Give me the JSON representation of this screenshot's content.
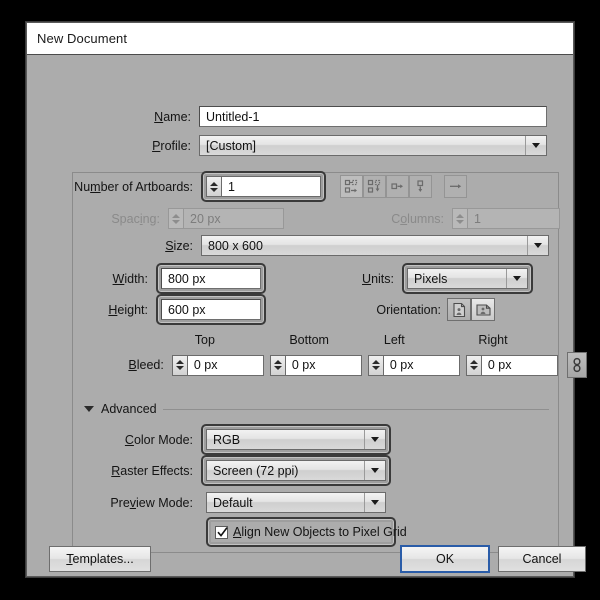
{
  "window": {
    "title": "New Document"
  },
  "fields": {
    "name": {
      "label": "Name:",
      "value": "Untitled-1"
    },
    "profile": {
      "label": "Profile:",
      "value": "[Custom]"
    },
    "artboards": {
      "label": "Number of Artboards:",
      "value": "1"
    },
    "spacing": {
      "label": "Spacing:",
      "value": "20 px",
      "enabled": false
    },
    "columns": {
      "label": "Columns:",
      "value": "1",
      "enabled": false
    },
    "size": {
      "label": "Size:",
      "value": "800 x 600"
    },
    "width": {
      "label": "Width:",
      "value": "800 px"
    },
    "height": {
      "label": "Height:",
      "value": "600 px"
    },
    "units": {
      "label": "Units:",
      "value": "Pixels"
    },
    "orientation": {
      "label": "Orientation:",
      "selected": "portrait"
    },
    "bleed": {
      "label": "Bleed:",
      "headers": [
        "Top",
        "Bottom",
        "Left",
        "Right"
      ],
      "values": [
        "0 px",
        "0 px",
        "0 px",
        "0 px"
      ],
      "link_icon": "chain-link-icon"
    }
  },
  "artboard_layout_buttons": [
    {
      "icon": "grid-by-row-icon",
      "selected": true
    },
    {
      "icon": "grid-by-column-icon",
      "selected": false
    },
    {
      "icon": "arrange-by-row-icon",
      "selected": false
    },
    {
      "icon": "arrange-by-column-icon",
      "selected": false
    },
    {
      "icon": "change-to-right-to-left-layout-icon",
      "selected": false
    }
  ],
  "advanced": {
    "title": "Advanced",
    "expanded": true,
    "color_mode": {
      "label": "Color Mode:",
      "value": "RGB"
    },
    "raster_effects": {
      "label": "Raster Effects:",
      "value": "Screen (72 ppi)"
    },
    "preview_mode": {
      "label": "Preview Mode:",
      "value": "Default"
    },
    "align_pixel_grid": {
      "label": "Align New Objects to Pixel Grid",
      "checked": true
    }
  },
  "footer": {
    "templates": "Templates...",
    "ok": "OK",
    "cancel": "Cancel"
  },
  "colors": {
    "dialog_bg": "#acacac",
    "titlebar_bg": "#ffffff",
    "focus_ring": "#3a3a3a",
    "default_button_border": "#2a5ca8"
  }
}
